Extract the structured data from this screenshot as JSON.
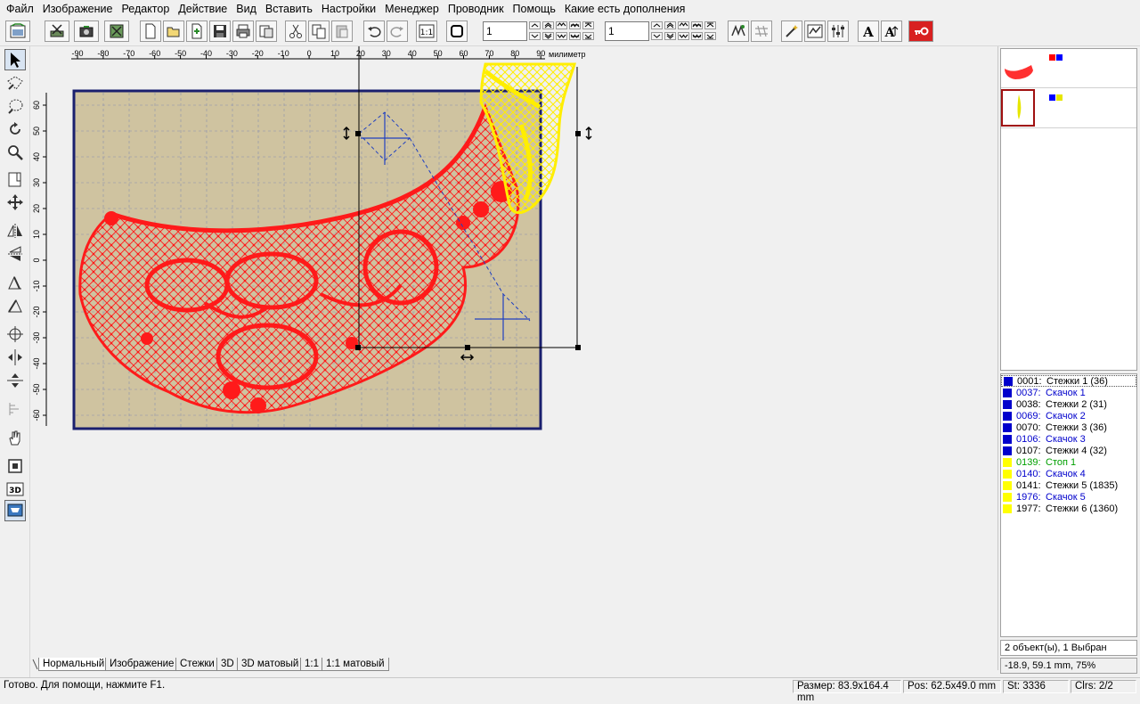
{
  "menu": [
    "Файл",
    "Изображение",
    "Редактор",
    "Действие",
    "Вид",
    "Вставить",
    "Настройки",
    "Менеджер",
    "Проводник",
    "Помощь",
    "Какие есть дополнения"
  ],
  "toolbar": {
    "spin1_value": "1",
    "spin2_value": "1"
  },
  "ruler": {
    "unit": "милиметр",
    "hticks": [
      "-90",
      "-80",
      "-70",
      "-60",
      "-50",
      "-40",
      "-30",
      "-20",
      "-10",
      "0",
      "10",
      "20",
      "30",
      "40",
      "50",
      "60",
      "70",
      "80",
      "90"
    ],
    "vticks": [
      "60",
      "50",
      "40",
      "30",
      "20",
      "10",
      "0",
      "-10",
      "-20",
      "-30",
      "-40",
      "-50",
      "-60"
    ]
  },
  "colors": {
    "hoop": "#cfc3a0",
    "hoop_border": "#1a1f6e",
    "design_red": "#ff1a1a",
    "design_yellow": "#ffff00",
    "grid": "#8a90b0"
  },
  "objects": [
    {
      "num": "0001:",
      "label": "Стежки 1 (36)",
      "color": "#0000cc",
      "text_color": "#000000"
    },
    {
      "num": "0037:",
      "label": "Скачок 1",
      "color": "#0000cc",
      "text_color": "#0000cc"
    },
    {
      "num": "0038:",
      "label": "Стежки 2 (31)",
      "color": "#0000cc",
      "text_color": "#000000"
    },
    {
      "num": "0069:",
      "label": "Скачок 2",
      "color": "#0000cc",
      "text_color": "#0000cc"
    },
    {
      "num": "0070:",
      "label": "Стежки 3 (36)",
      "color": "#0000cc",
      "text_color": "#000000"
    },
    {
      "num": "0106:",
      "label": "Скачок 3",
      "color": "#0000cc",
      "text_color": "#0000cc"
    },
    {
      "num": "0107:",
      "label": "Стежки 4 (32)",
      "color": "#0000cc",
      "text_color": "#000000"
    },
    {
      "num": "0139:",
      "label": "Стоп 1",
      "color": "#ffff00",
      "text_color": "#00a000"
    },
    {
      "num": "0140:",
      "label": "Скачок 4",
      "color": "#ffff00",
      "text_color": "#0000cc"
    },
    {
      "num": "0141:",
      "label": "Стежки 5 (1835)",
      "color": "#ffff00",
      "text_color": "#000000"
    },
    {
      "num": "1976:",
      "label": "Скачок 5",
      "color": "#ffff00",
      "text_color": "#0000cc"
    },
    {
      "num": "1977:",
      "label": "Стежки 6 (1360)",
      "color": "#ffff00",
      "text_color": "#000000"
    }
  ],
  "panel": {
    "summary": "2 объект(ы), 1 Выбран",
    "coords": "-18.9, 59.1 mm, 75%"
  },
  "tabs": [
    "Нормальный",
    "Изображение",
    "Стежки",
    "3D",
    "3D матовый",
    "1:1",
    "1:1 матовый"
  ],
  "status": {
    "ready": "Готово. Для помощи, нажмите F1.",
    "size": "Размер: 83.9x164.4 mm",
    "pos": "Pos: 62.5x49.0 mm",
    "st": "St: 3336",
    "clrs": "Clrs: 2/2"
  }
}
